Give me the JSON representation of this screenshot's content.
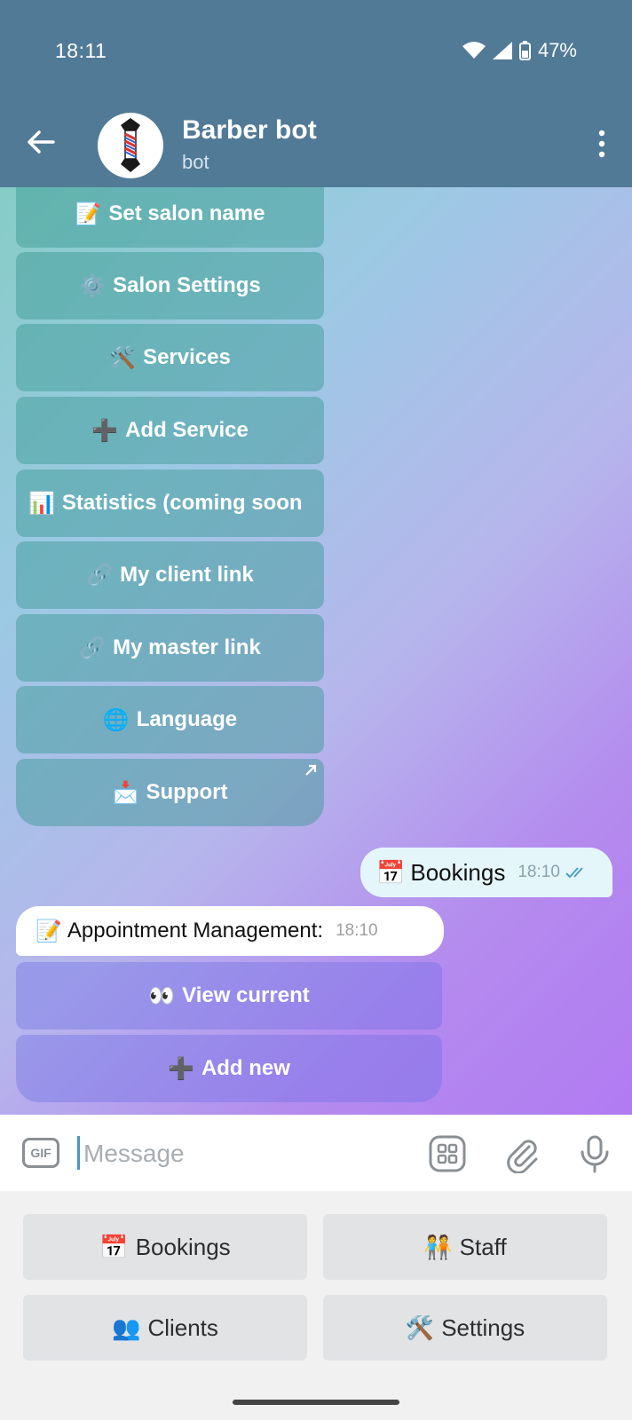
{
  "status": {
    "time": "18:11",
    "battery": "47%"
  },
  "header": {
    "title": "Barber bot",
    "subtitle": "bot"
  },
  "menu_buttons": [
    {
      "emoji": "📝",
      "label": "Set salon name"
    },
    {
      "emoji": "⚙️",
      "label": "Salon Settings"
    },
    {
      "emoji": "🛠️",
      "label": "Services"
    },
    {
      "emoji": "➕",
      "label": "Add Service"
    },
    {
      "emoji": "📊",
      "label": "Statistics (coming soon"
    },
    {
      "emoji": "🔗",
      "label": "My client link"
    },
    {
      "emoji": "🔗",
      "label": "My master link"
    },
    {
      "emoji": "🌐",
      "label": "Language"
    },
    {
      "emoji": "📩",
      "label": "Support"
    }
  ],
  "outgoing": {
    "emoji": "📅",
    "text": "Bookings",
    "time": "18:10"
  },
  "incoming": {
    "emoji": "📝",
    "text": "Appointment Management:",
    "time": "18:10"
  },
  "appointment_buttons": [
    {
      "emoji": "👀",
      "label": "View current"
    },
    {
      "emoji": "➕",
      "label": "Add new"
    }
  ],
  "input": {
    "gif_label": "GIF",
    "placeholder": "Message"
  },
  "reply_keyboard": [
    {
      "emoji": "📅",
      "label": "Bookings"
    },
    {
      "emoji": "🧑‍🤝‍🧑",
      "label": "Staff"
    },
    {
      "emoji": "👥",
      "label": "Clients"
    },
    {
      "emoji": "🛠️",
      "label": "Settings"
    }
  ]
}
